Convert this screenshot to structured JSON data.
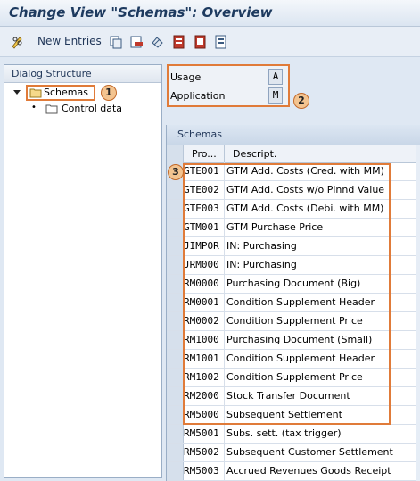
{
  "window": {
    "title": "Change View \"Schemas\": Overview"
  },
  "toolbar": {
    "new_entries_label": "New Entries",
    "icons": [
      "pencil-glasses-icon",
      "copy-icon",
      "delete-icon",
      "undo-icon",
      "select-all-icon",
      "deselect-icon",
      "select-block-icon"
    ]
  },
  "dialog_structure": {
    "header": "Dialog Structure",
    "items": [
      {
        "label": "Schemas",
        "selected": true,
        "expanded": true
      },
      {
        "label": "Control data",
        "selected": false
      }
    ]
  },
  "fields": {
    "usage": {
      "label": "Usage",
      "value": "A"
    },
    "application": {
      "label": "Application",
      "value": "M"
    }
  },
  "schemas": {
    "title": "Schemas",
    "columns": [
      "Pro...",
      "Descript."
    ],
    "rows": [
      {
        "code": "GTE001",
        "desc": "GTM Add. Costs (Cred. with MM)"
      },
      {
        "code": "GTE002",
        "desc": "GTM Add. Costs w/o Plnnd Value"
      },
      {
        "code": "GTE003",
        "desc": "GTM Add. Costs (Debi. with MM)"
      },
      {
        "code": "GTM001",
        "desc": "GTM Purchase Price"
      },
      {
        "code": "JIMPOR",
        "desc": "IN: Purchasing"
      },
      {
        "code": "JRM000",
        "desc": "IN: Purchasing"
      },
      {
        "code": "RM0000",
        "desc": "Purchasing Document (Big)"
      },
      {
        "code": "RM0001",
        "desc": "Condition Supplement Header"
      },
      {
        "code": "RM0002",
        "desc": "Condition Supplement Price"
      },
      {
        "code": "RM1000",
        "desc": "Purchasing Document (Small)"
      },
      {
        "code": "RM1001",
        "desc": "Condition Supplement Header"
      },
      {
        "code": "RM1002",
        "desc": "Condition Supplement Price"
      },
      {
        "code": "RM2000",
        "desc": "Stock Transfer Document"
      },
      {
        "code": "RM5000",
        "desc": "Subsequent Settlement"
      },
      {
        "code": "RM5001",
        "desc": "Subs. sett. (tax trigger)"
      },
      {
        "code": "RM5002",
        "desc": "Subsequent Customer Settlement"
      },
      {
        "code": "RM5003",
        "desc": "Accrued Revenues Goods Receipt"
      }
    ]
  },
  "annotations": {
    "badge1": "1",
    "badge2": "2",
    "badge3": "3"
  },
  "colors": {
    "highlight": "#e07b39",
    "title": "#1d3a5f",
    "background": "#dfe8f3"
  }
}
